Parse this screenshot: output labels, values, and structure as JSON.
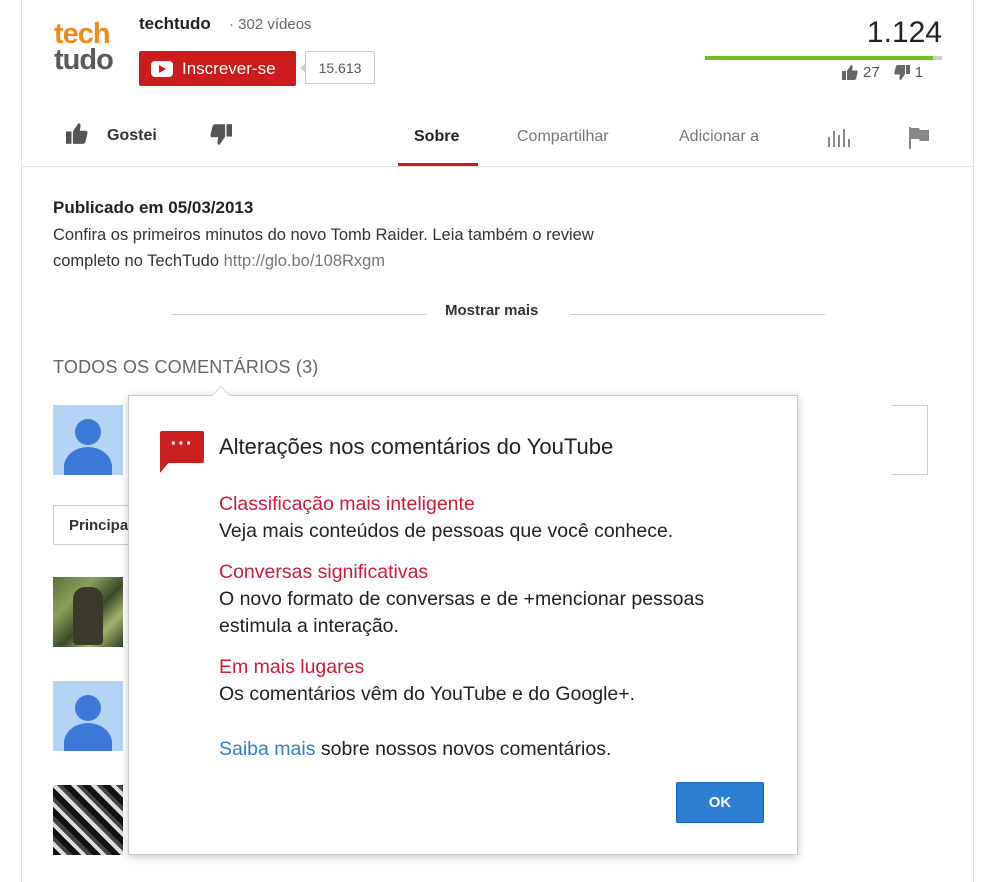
{
  "channel": {
    "logo_top": "tech",
    "logo_bottom": "tudo",
    "name": "techtudo",
    "videos": "· 302 vídeos",
    "subscribe_label": "Inscrever-se",
    "subscriber_count": "15.613"
  },
  "stats": {
    "views": "1.124",
    "likes": "27",
    "dislikes": "1",
    "like_ratio": 0.964
  },
  "actions": {
    "like_label": "Gostei",
    "tabs": [
      "Sobre",
      "Compartilhar",
      "Adicionar a"
    ]
  },
  "description": {
    "published": "Publicado em 05/03/2013",
    "text": "Confira os primeiros minutos do novo Tomb Raider. Leia também o review completo no TechTudo ",
    "link": "http://glo.bo/108Rxgm",
    "show_more": "Mostrar mais"
  },
  "comments": {
    "title": "TODOS OS COMENTÁRIOS (3)",
    "sort_label": "Principais"
  },
  "popup": {
    "title": "Alterações nos comentários do YouTube",
    "sections": [
      {
        "heading": "Classificação mais inteligente",
        "body": "Veja mais conteúdos de pessoas que você conhece."
      },
      {
        "heading": "Conversas significativas",
        "body": "O novo formato de conversas e de +mencionar pessoas estimula a interação."
      },
      {
        "heading": "Em mais lugares",
        "body": "Os comentários vêm do YouTube e do Google+."
      }
    ],
    "learn_more_link": "Saiba mais",
    "learn_more_text": " sobre nossos novos comentários.",
    "ok_label": "OK"
  },
  "colors": {
    "youtube_red": "#cc1b1b",
    "link_blue": "#2f7ec6",
    "like_green": "#6fbf1e"
  }
}
